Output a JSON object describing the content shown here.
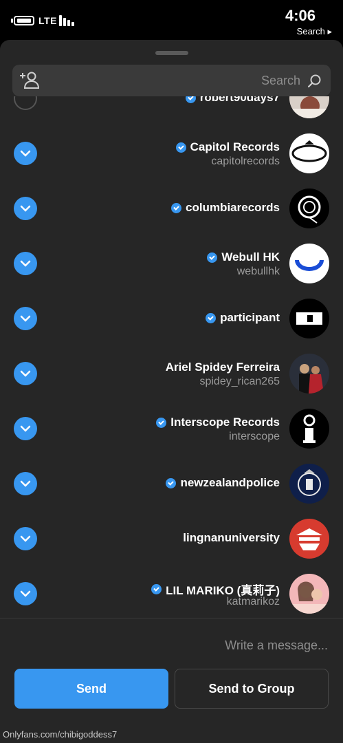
{
  "status_bar": {
    "network": "LTE",
    "time": "4:06",
    "back_label": "Search ▸"
  },
  "search": {
    "placeholder": "Search"
  },
  "contacts": [
    {
      "name": "robert90days7",
      "username": "",
      "verified": true,
      "selected": false
    },
    {
      "name": "Capitol Records",
      "username": "capitolrecords",
      "verified": true,
      "selected": true
    },
    {
      "name": "columbiarecords",
      "username": "",
      "verified": true,
      "selected": true
    },
    {
      "name": "Webull HK",
      "username": "webullhk",
      "verified": true,
      "selected": true
    },
    {
      "name": "participant",
      "username": "",
      "verified": true,
      "selected": true
    },
    {
      "name": "Ariel Spidey Ferreira",
      "username": "spidey_rican265",
      "verified": false,
      "selected": true
    },
    {
      "name": "Interscope Records",
      "username": "interscope",
      "verified": true,
      "selected": true
    },
    {
      "name": "newzealandpolice",
      "username": "",
      "verified": true,
      "selected": true
    },
    {
      "name": "lingnanuniversity",
      "username": "",
      "verified": false,
      "selected": true
    },
    {
      "name": "LIL MARIKO (真莉子)",
      "username": "katmarikoz",
      "verified": true,
      "selected": true
    }
  ],
  "composer": {
    "placeholder": "Write a message..."
  },
  "buttons": {
    "send": "Send",
    "send_to_group": "Send to Group"
  },
  "watermark": "Onlyfans.com/chibigoddess7",
  "colors": {
    "accent": "#3897f0",
    "sheet": "#262626",
    "muted_text": "#9a9a9a"
  }
}
